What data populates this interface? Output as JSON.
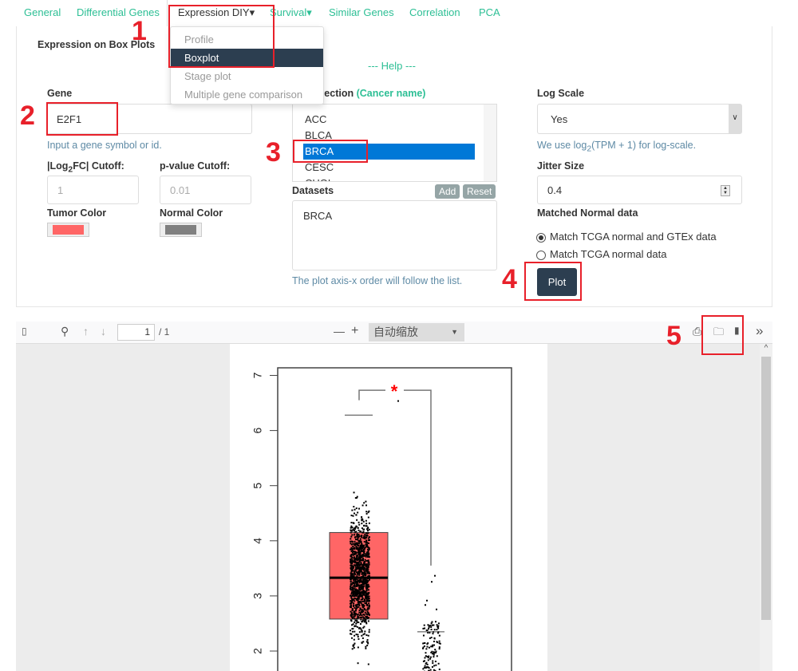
{
  "nav": {
    "items": [
      "General",
      "Differential Genes",
      "Expression DIY",
      "Survival",
      "Similar Genes",
      "Correlation",
      "PCA"
    ],
    "caret": "▾"
  },
  "menu": {
    "items": [
      "Profile",
      "Boxplot",
      "Stage plot",
      "Multiple gene comparison"
    ],
    "selected": "Boxplot"
  },
  "panel": {
    "title": "Expression on Box Plots",
    "help": "--- Help ---"
  },
  "gene": {
    "label": "Gene",
    "value": "E2F1",
    "hint": "Input a gene symbol or id."
  },
  "cutoffs": {
    "log2fc_label_pre": "|Log",
    "log2fc_sub": "2",
    "log2fc_label_post": "FC| Cutoff:",
    "log2fc_placeholder": "1",
    "pvalue_label": "p-value Cutoff:",
    "pvalue_placeholder": "0.01"
  },
  "colors": {
    "tumor_label": "Tumor Color",
    "tumor": "#ff6666",
    "normal_label": "Normal Color",
    "normal": "#808080"
  },
  "datasets_selection": {
    "label": "ets Selection",
    "label_accent": "(Cancer name)",
    "options": [
      "ACC",
      "BLCA",
      "BRCA",
      "CESC",
      "CHOL"
    ],
    "selected": "BRCA"
  },
  "datasets": {
    "label": "Datasets",
    "add": "Add",
    "reset": "Reset",
    "value": "BRCA",
    "hint": "The plot axis-x order will follow the list."
  },
  "log_scale": {
    "label": "Log Scale",
    "value": "Yes",
    "hint_pre": "We use log",
    "hint_sub": "2",
    "hint_post": "(TPM + 1) for log-scale."
  },
  "jitter": {
    "label": "Jitter Size",
    "value": "0.4"
  },
  "matched_normal": {
    "label": "Matched Normal data",
    "options": [
      "Match TCGA normal and GTEx data",
      "Match TCGA normal data"
    ],
    "selected": 0
  },
  "plot_button": "Plot",
  "annotations": [
    "1",
    "2",
    "3",
    "4",
    "5"
  ],
  "pdf_toolbar": {
    "page": "1",
    "page_total": "/ 1",
    "zoom": "自动缩放",
    "minus": "—",
    "plus": "+",
    "more": "»"
  },
  "chart_data": {
    "type": "box",
    "yticks": [
      2,
      3,
      4,
      5,
      6,
      7
    ],
    "ylim": [
      1.64,
      7.14
    ],
    "groups": [
      {
        "color": "#ff6666",
        "q1": 2.58,
        "median": 3.33,
        "q3": 4.15,
        "whisker_high": 6.28,
        "max_point": 6.55
      },
      {
        "color": "#808080",
        "median": 2.35,
        "max_point": 3.38
      }
    ],
    "significance": "*"
  }
}
